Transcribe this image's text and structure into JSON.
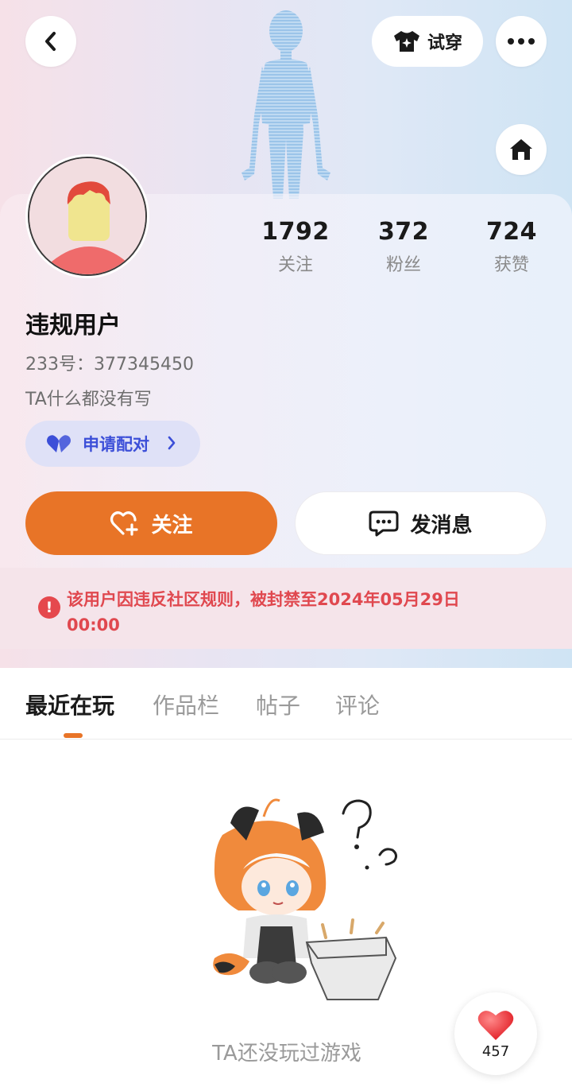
{
  "header": {
    "try_on_label": "试穿",
    "icons": {
      "back": "chevron-left-icon",
      "shirt": "shirt-icon",
      "more": "more-icon",
      "home": "home-icon"
    }
  },
  "profile": {
    "stats": [
      {
        "value": "1792",
        "label": "关注"
      },
      {
        "value": "372",
        "label": "粉丝"
      },
      {
        "value": "724",
        "label": "获赞"
      }
    ],
    "username": "违规用户",
    "user_id": "233号：377345450",
    "bio": "TA什么都没有写",
    "pair_button_label": "申请配对",
    "follow_button_label": "关注",
    "message_button_label": "发消息"
  },
  "ban_notice": {
    "text": "该用户因违反社区规则，被封禁至2024年05月29日 00:00",
    "color": "#e0484f"
  },
  "tabs": [
    {
      "label": "最近在玩",
      "active": true
    },
    {
      "label": "作品栏",
      "active": false
    },
    {
      "label": "帖子",
      "active": false
    },
    {
      "label": "评论",
      "active": false
    }
  ],
  "empty_state": {
    "text": "TA还没玩过游戏"
  },
  "like_fab": {
    "count": "457"
  },
  "colors": {
    "accent": "#e87427",
    "pair_text": "#3c4fd8",
    "pair_bg": "#dfe1f7"
  }
}
